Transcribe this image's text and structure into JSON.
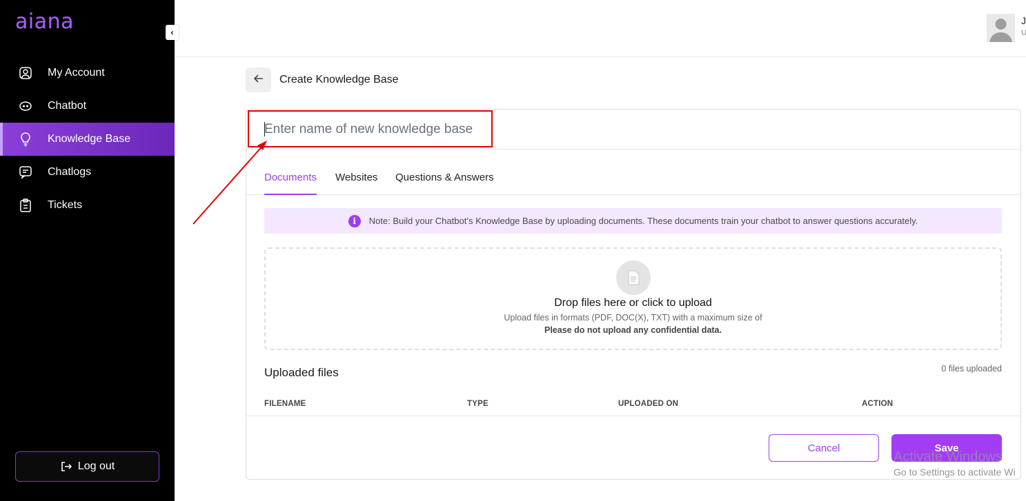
{
  "app": {
    "logo": "aiana"
  },
  "sidebar": {
    "items": [
      {
        "label": "My Account",
        "icon": "user-square-icon",
        "active": false
      },
      {
        "label": "Chatbot",
        "icon": "chatbot-icon",
        "active": false
      },
      {
        "label": "Knowledge Base",
        "icon": "lightbulb-icon",
        "active": true
      },
      {
        "label": "Chatlogs",
        "icon": "message-icon",
        "active": false
      },
      {
        "label": "Tickets",
        "icon": "clipboard-icon",
        "active": false
      }
    ],
    "logout_label": "Log out"
  },
  "header": {
    "user_initial": "J",
    "user_sub": "U"
  },
  "page": {
    "title": "Create Knowledge Base"
  },
  "form": {
    "name_placeholder": "Enter name of new knowledge base"
  },
  "tabs": [
    {
      "label": "Documents",
      "active": true
    },
    {
      "label": "Websites",
      "active": false
    },
    {
      "label": "Questions & Answers",
      "active": false
    }
  ],
  "note": {
    "text": "Note: Build your Chatbot’s Knowledge Base by uploading documents. These documents train your chatbot to answer questions accurately."
  },
  "dropzone": {
    "title": "Drop files here or click to upload",
    "subtitle": "Upload files in formats (PDF, DOC(X), TXT) with a maximum size of",
    "warning": "Please do not upload any confidential data."
  },
  "uploaded": {
    "title": "Uploaded files",
    "count": "0 files uploaded",
    "columns": [
      "FILENAME",
      "TYPE",
      "UPLOADED ON",
      "ACTION"
    ]
  },
  "actions": {
    "cancel": "Cancel",
    "save": "Save"
  },
  "watermark": {
    "line1": "Activate Windows",
    "line2": "Go to Settings to activate Wi"
  },
  "colors": {
    "accent": "#9b3ff0",
    "sidebar_bg": "#000000",
    "annotation": "#e00000"
  }
}
